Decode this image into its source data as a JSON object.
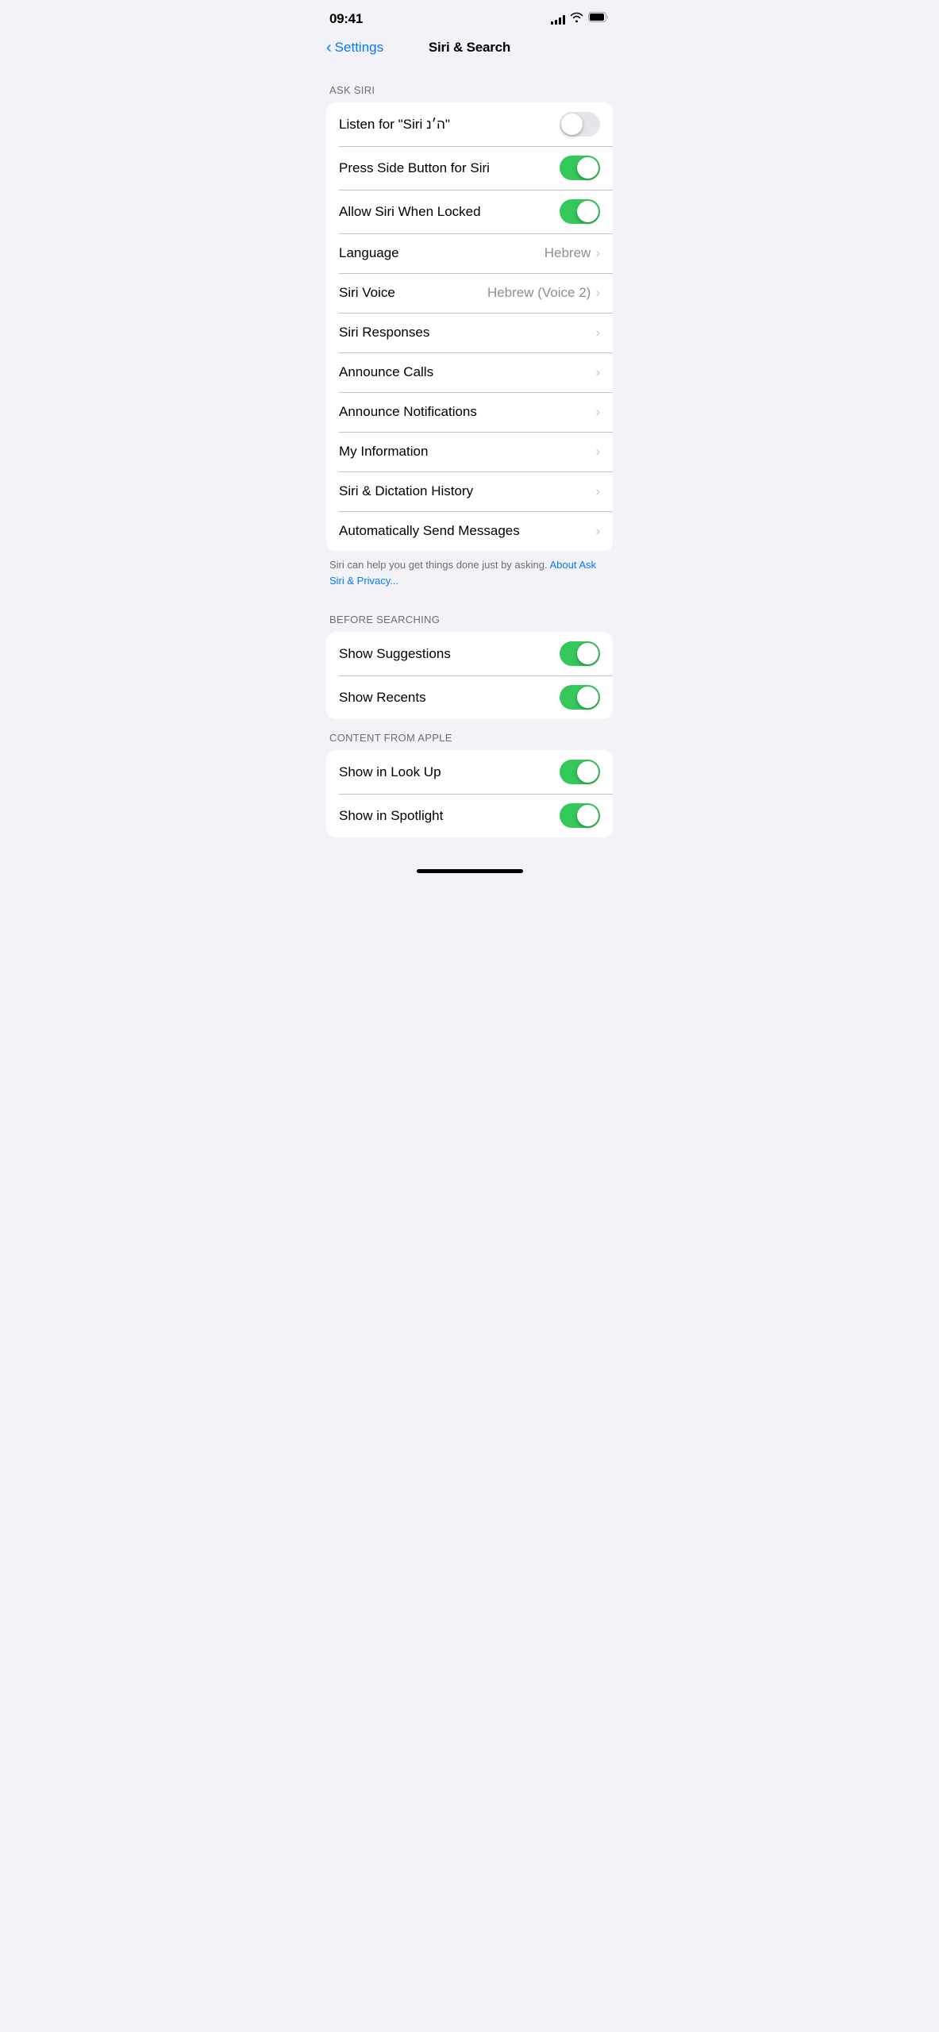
{
  "statusBar": {
    "time": "09:41",
    "signalBars": [
      4,
      6,
      8,
      10,
      12
    ],
    "wifiLabel": "wifi",
    "batteryLabel": "battery"
  },
  "nav": {
    "backLabel": "Settings",
    "title": "Siri & Search"
  },
  "askSiri": {
    "sectionLabel": "ASK SIRI",
    "rows": [
      {
        "id": "listen-siri",
        "label": "Listen for “Siri ה״נ”",
        "type": "toggle",
        "toggleState": "off"
      },
      {
        "id": "press-side",
        "label": "Press Side Button for Siri",
        "type": "toggle",
        "toggleState": "on"
      },
      {
        "id": "allow-locked",
        "label": "Allow Siri When Locked",
        "type": "toggle",
        "toggleState": "on"
      },
      {
        "id": "language",
        "label": "Language",
        "type": "value-chevron",
        "value": "Hebrew"
      },
      {
        "id": "siri-voice",
        "label": "Siri Voice",
        "type": "value-chevron",
        "value": "Hebrew (Voice 2)"
      },
      {
        "id": "siri-responses",
        "label": "Siri Responses",
        "type": "chevron",
        "value": ""
      },
      {
        "id": "announce-calls",
        "label": "Announce Calls",
        "type": "chevron",
        "value": ""
      },
      {
        "id": "announce-notifications",
        "label": "Announce Notifications",
        "type": "chevron",
        "value": ""
      },
      {
        "id": "my-information",
        "label": "My Information",
        "type": "chevron",
        "value": ""
      },
      {
        "id": "siri-dictation-history",
        "label": "Siri & Dictation History",
        "type": "chevron",
        "value": ""
      },
      {
        "id": "auto-send-messages",
        "label": "Automatically Send Messages",
        "type": "chevron",
        "value": ""
      }
    ],
    "footerText": "Siri can help you get things done just by asking. ",
    "footerLinkText": "About Ask Siri & Privacy..."
  },
  "beforeSearching": {
    "sectionLabel": "BEFORE SEARCHING",
    "rows": [
      {
        "id": "show-suggestions",
        "label": "Show Suggestions",
        "type": "toggle",
        "toggleState": "on"
      },
      {
        "id": "show-recents",
        "label": "Show Recents",
        "type": "toggle",
        "toggleState": "on"
      }
    ]
  },
  "contentFromApple": {
    "sectionLabel": "CONTENT FROM APPLE",
    "rows": [
      {
        "id": "show-in-look-up",
        "label": "Show in Look Up",
        "type": "toggle",
        "toggleState": "on"
      },
      {
        "id": "show-in-spotlight",
        "label": "Show in Spotlight",
        "type": "toggle",
        "toggleState": "on"
      }
    ]
  }
}
